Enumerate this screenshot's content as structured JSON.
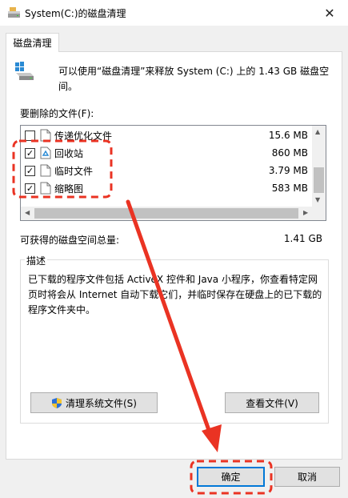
{
  "window": {
    "title": "System(C:)的磁盘清理",
    "close_glyph": "✕"
  },
  "tab": {
    "label": "磁盘清理"
  },
  "intro": {
    "text": "可以使用“磁盘清理”来释放 System (C:) 上的 1.43 GB 磁盘空间。"
  },
  "files": {
    "label": "要删除的文件(F):",
    "items": [
      {
        "name": "传递优化文件",
        "size": "15.6 MB",
        "checked": false
      },
      {
        "name": "回收站",
        "size": "860 MB",
        "checked": true
      },
      {
        "name": "临时文件",
        "size": "3.79 MB",
        "checked": true
      },
      {
        "name": "缩略图",
        "size": "583 MB",
        "checked": true
      }
    ]
  },
  "space": {
    "label": "可获得的磁盘空间总量:",
    "value": "1.41 GB"
  },
  "description": {
    "title": "描述",
    "text": "已下载的程序文件包括 ActiveX 控件和 Java 小程序，你查看特定网页时将会从 Internet 自动下载它们，并临时保存在硬盘上的已下载的程序文件夹中。"
  },
  "buttons": {
    "clean_system": "清理系统文件(S)",
    "view_files": "查看文件(V)",
    "ok": "确定",
    "cancel": "取消"
  },
  "colors": {
    "annotation": "#ea3323",
    "focus": "#0078d7"
  },
  "icons": {
    "app": "disk-cleanup-icon",
    "drive": "drive-icon",
    "shield": "uac-shield-icon",
    "recycle": "recycle-bin-icon",
    "file": "file-icon"
  }
}
